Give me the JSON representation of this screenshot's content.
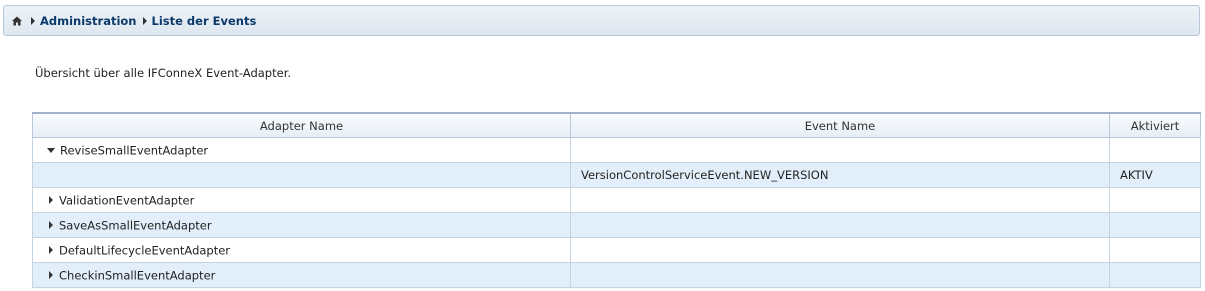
{
  "breadcrumb": {
    "home_icon": "home-icon",
    "items": [
      "Administration",
      "Liste der Events"
    ]
  },
  "intro": "Übersicht über alle IFConneX Event-Adapter.",
  "table": {
    "headers": [
      "Adapter Name",
      "Event Name",
      "Aktiviert"
    ],
    "rows": [
      {
        "adapter": "ReviseSmallEventAdapter",
        "event": "",
        "active": "",
        "toggle": "expanded"
      },
      {
        "adapter": "",
        "event": "VersionControlServiceEvent.NEW_VERSION",
        "active": "AKTIV",
        "toggle": "none"
      },
      {
        "adapter": "ValidationEventAdapter",
        "event": "",
        "active": "",
        "toggle": "collapsed"
      },
      {
        "adapter": "SaveAsSmallEventAdapter",
        "event": "",
        "active": "",
        "toggle": "collapsed"
      },
      {
        "adapter": "DefaultLifecycleEventAdapter",
        "event": "",
        "active": "",
        "toggle": "collapsed"
      },
      {
        "adapter": "CheckinSmallEventAdapter",
        "event": "",
        "active": "",
        "toggle": "collapsed"
      }
    ]
  },
  "colors": {
    "link": "#0b3a6a",
    "row_alt": "#e2eef9",
    "border": "#c5d4e3"
  }
}
